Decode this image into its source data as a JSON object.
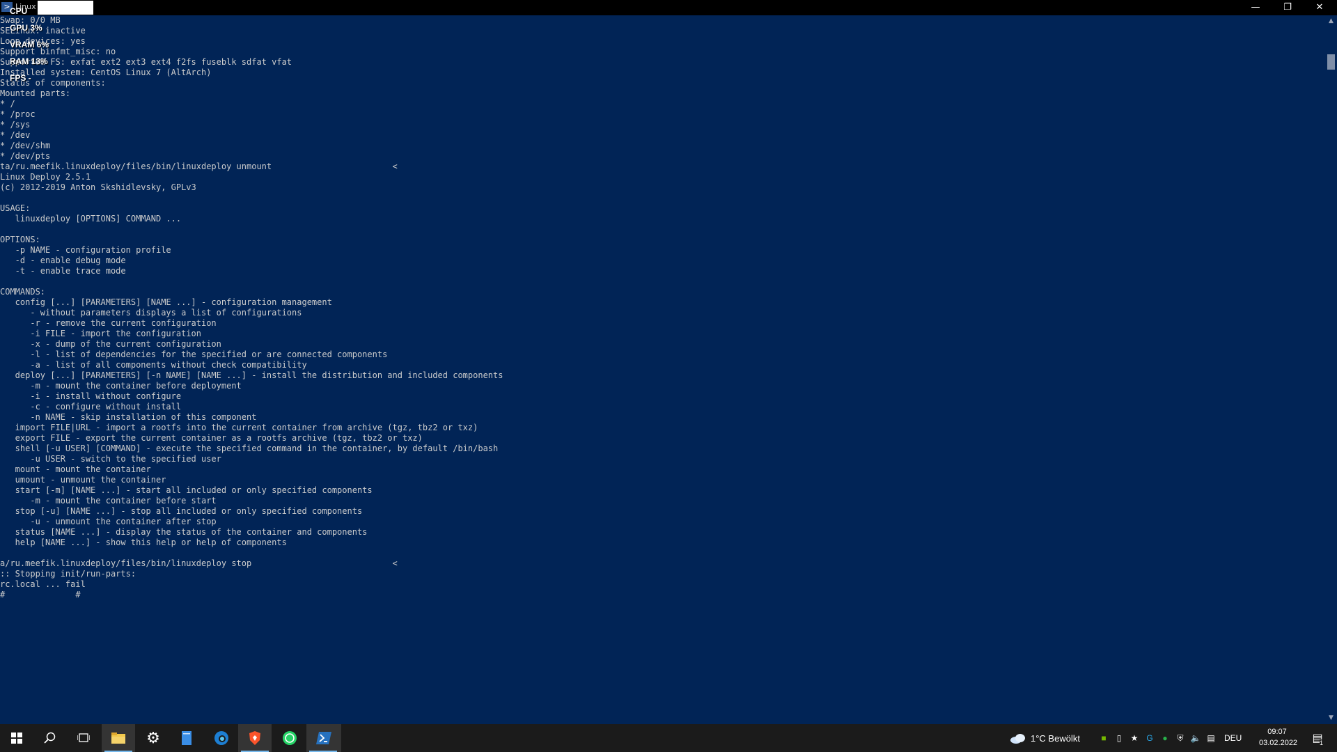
{
  "window": {
    "title": "Linux Deploy"
  },
  "overlay": {
    "cpu": "CPU",
    "gpu": "GPU  3%",
    "vram": "VRAM  6%",
    "ram": "RAM  13%",
    "fps": "FPS  -"
  },
  "terminal": {
    "lines": [
      "Swap: 0/0 MB",
      "SELinux: inactive",
      "Loop devices: yes",
      "Support binfmt_misc: no",
      "Supported FS: exfat ext2 ext3 ext4 f2fs fuseblk sdfat vfat",
      "Installed system: CentOS Linux 7 (AltArch)",
      "Status of components:",
      "Mounted parts:",
      "* /",
      "* /proc",
      "* /sys",
      "* /dev",
      "* /dev/shm",
      "* /dev/pts",
      "ta/ru.meefik.linuxdeploy/files/bin/linuxdeploy unmount                        <",
      "Linux Deploy 2.5.1",
      "(c) 2012-2019 Anton Skshidlevsky, GPLv3",
      "",
      "USAGE:",
      "   linuxdeploy [OPTIONS] COMMAND ...",
      "",
      "OPTIONS:",
      "   -p NAME - configuration profile",
      "   -d - enable debug mode",
      "   -t - enable trace mode",
      "",
      "COMMANDS:",
      "   config [...] [PARAMETERS] [NAME ...] - configuration management",
      "      - without parameters displays a list of configurations",
      "      -r - remove the current configuration",
      "      -i FILE - import the configuration",
      "      -x - dump of the current configuration",
      "      -l - list of dependencies for the specified or are connected components",
      "      -a - list of all components without check compatibility",
      "   deploy [...] [PARAMETERS] [-n NAME] [NAME ...] - install the distribution and included components",
      "      -m - mount the container before deployment",
      "      -i - install without configure",
      "      -c - configure without install",
      "      -n NAME - skip installation of this component",
      "   import FILE|URL - import a rootfs into the current container from archive (tgz, tbz2 or txz)",
      "   export FILE - export the current container as a rootfs archive (tgz, tbz2 or txz)",
      "   shell [-u USER] [COMMAND] - execute the specified command in the container, by default /bin/bash",
      "      -u USER - switch to the specified user",
      "   mount - mount the container",
      "   umount - unmount the container",
      "   start [-m] [NAME ...] - start all included or only specified components",
      "      -m - mount the container before start",
      "   stop [-u] [NAME ...] - stop all included or only specified components",
      "      -u - unmount the container after stop",
      "   status [NAME ...] - display the status of the container and components",
      "   help [NAME ...] - show this help or help of components",
      "",
      "a/ru.meefik.linuxdeploy/files/bin/linuxdeploy stop                            <",
      ":: Stopping init/run-parts:",
      "rc.local ... fail",
      "#              #"
    ]
  },
  "taskbar": {
    "weather": "1°C  Bewölkt",
    "language": "DEU",
    "time": "09:07",
    "date": "03.02.2022",
    "notification_count": "1",
    "apps": [
      "start",
      "search",
      "task-view",
      "file-explorer",
      "settings",
      "notepad",
      "edge",
      "brave",
      "whatsapp",
      "powershell"
    ]
  },
  "colors": {
    "terminal_bg": "#012456",
    "terminal_fg": "#cccccc",
    "taskbar_bg": "#1b1b1b",
    "accent": "#76b9ed"
  }
}
